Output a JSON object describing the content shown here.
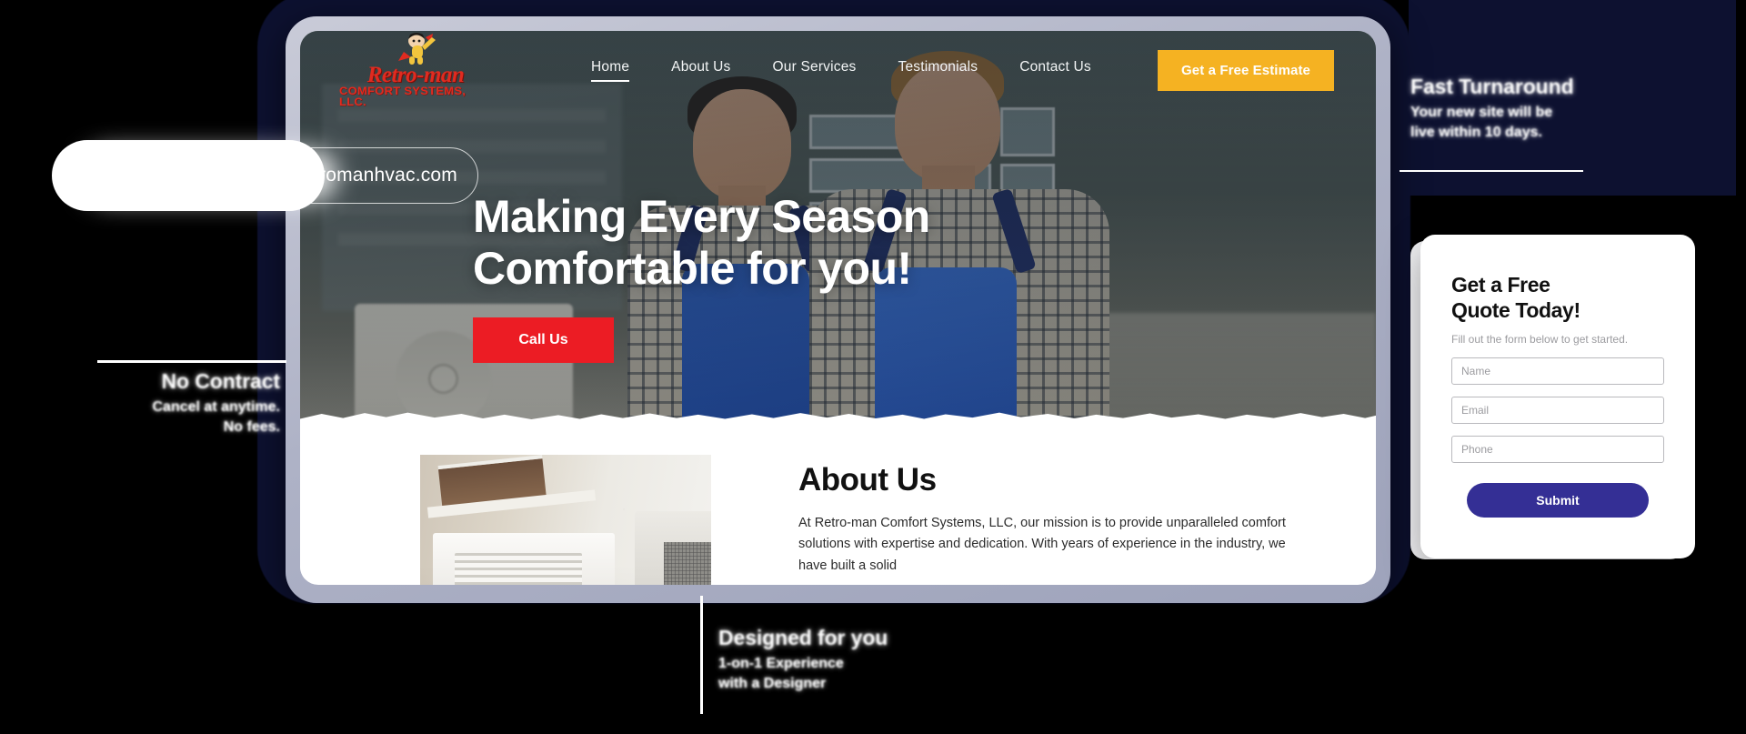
{
  "browser": {
    "url": "heretromanhvac.com"
  },
  "site": {
    "logo": {
      "word": "Retro-man",
      "subtitle": "COMFORT SYSTEMS, LLC.",
      "icon": "flying-superhero-mascot"
    },
    "nav": {
      "items": [
        {
          "label": "Home",
          "active": true
        },
        {
          "label": "About Us",
          "active": false
        },
        {
          "label": "Our Services",
          "active": false
        },
        {
          "label": "Testimonials",
          "active": false
        },
        {
          "label": "Contact Us",
          "active": false
        }
      ],
      "cta_label": "Get a Free Estimate",
      "cta_color": "#f5b222"
    },
    "hero": {
      "heading_line1": "Making Every Season",
      "heading_line2": "Comfortable for you!",
      "button_label": "Call Us",
      "button_color": "#ec1c24"
    },
    "about": {
      "heading": "About Us",
      "paragraph": "At Retro-man Comfort Systems, LLC, our mission is to provide unparalleled comfort solutions with expertise and dedication. With years of experience in the industry, we have built a solid",
      "image_alt": "outdoor-hvac-condenser-unit"
    }
  },
  "quote_card": {
    "title_line1": "Get a Free",
    "title_line2": "Quote Today!",
    "subtitle": "Fill out the form below to get started.",
    "fields": [
      {
        "name": "name",
        "placeholder": "Name",
        "value": ""
      },
      {
        "name": "email",
        "placeholder": "Email",
        "value": ""
      },
      {
        "name": "phone",
        "placeholder": "Phone",
        "value": ""
      }
    ],
    "submit_label": "Submit",
    "submit_color": "#342f95"
  },
  "annotations": {
    "right": {
      "title": "Fast Turnaround",
      "sub_line1": "Your new site will be",
      "sub_line2": "live within 10 days."
    },
    "left": {
      "title": "No Contract",
      "sub_line1": "Cancel at anytime.",
      "sub_line2": "No fees."
    },
    "bottom": {
      "title": "Designed for you",
      "sub_line1": "1-on-1 Experience",
      "sub_line2": "with a Designer"
    }
  },
  "theme": {
    "backdrop": "#0d1130",
    "bezel": "#aeb2c6"
  }
}
